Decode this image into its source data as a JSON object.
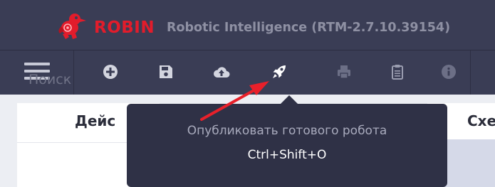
{
  "titlebar": {
    "brand": "ROBIN",
    "app_name": "Robotic Intelligence (RTM-2.7.10.39154)",
    "logo_icon": "robin-bird-icon"
  },
  "toolbar": {
    "buttons": [
      {
        "icon": "menu-icon",
        "enabled": true
      },
      {
        "icon": "add-icon",
        "enabled": true
      },
      {
        "icon": "save-icon",
        "enabled": true
      },
      {
        "icon": "upload-cloud-icon",
        "enabled": true
      },
      {
        "icon": "rocket-icon",
        "enabled": true,
        "hovered": true
      },
      {
        "icon": "print-icon",
        "enabled": false
      },
      {
        "icon": "clipboard-icon",
        "enabled": false
      },
      {
        "icon": "info-icon",
        "enabled": false
      }
    ]
  },
  "panels": {
    "left_tab": "Дейс",
    "right_tab": "Схе",
    "search_placeholder": "Поиск"
  },
  "tooltip": {
    "title": "Опубликовать готового робота",
    "shortcut": "Ctrl+Shift+O"
  },
  "colors": {
    "header_bg": "#3a3d55",
    "brand_red": "#e21c2b",
    "tooltip_bg": "#2f3146",
    "annotation_arrow": "#e8202a"
  }
}
